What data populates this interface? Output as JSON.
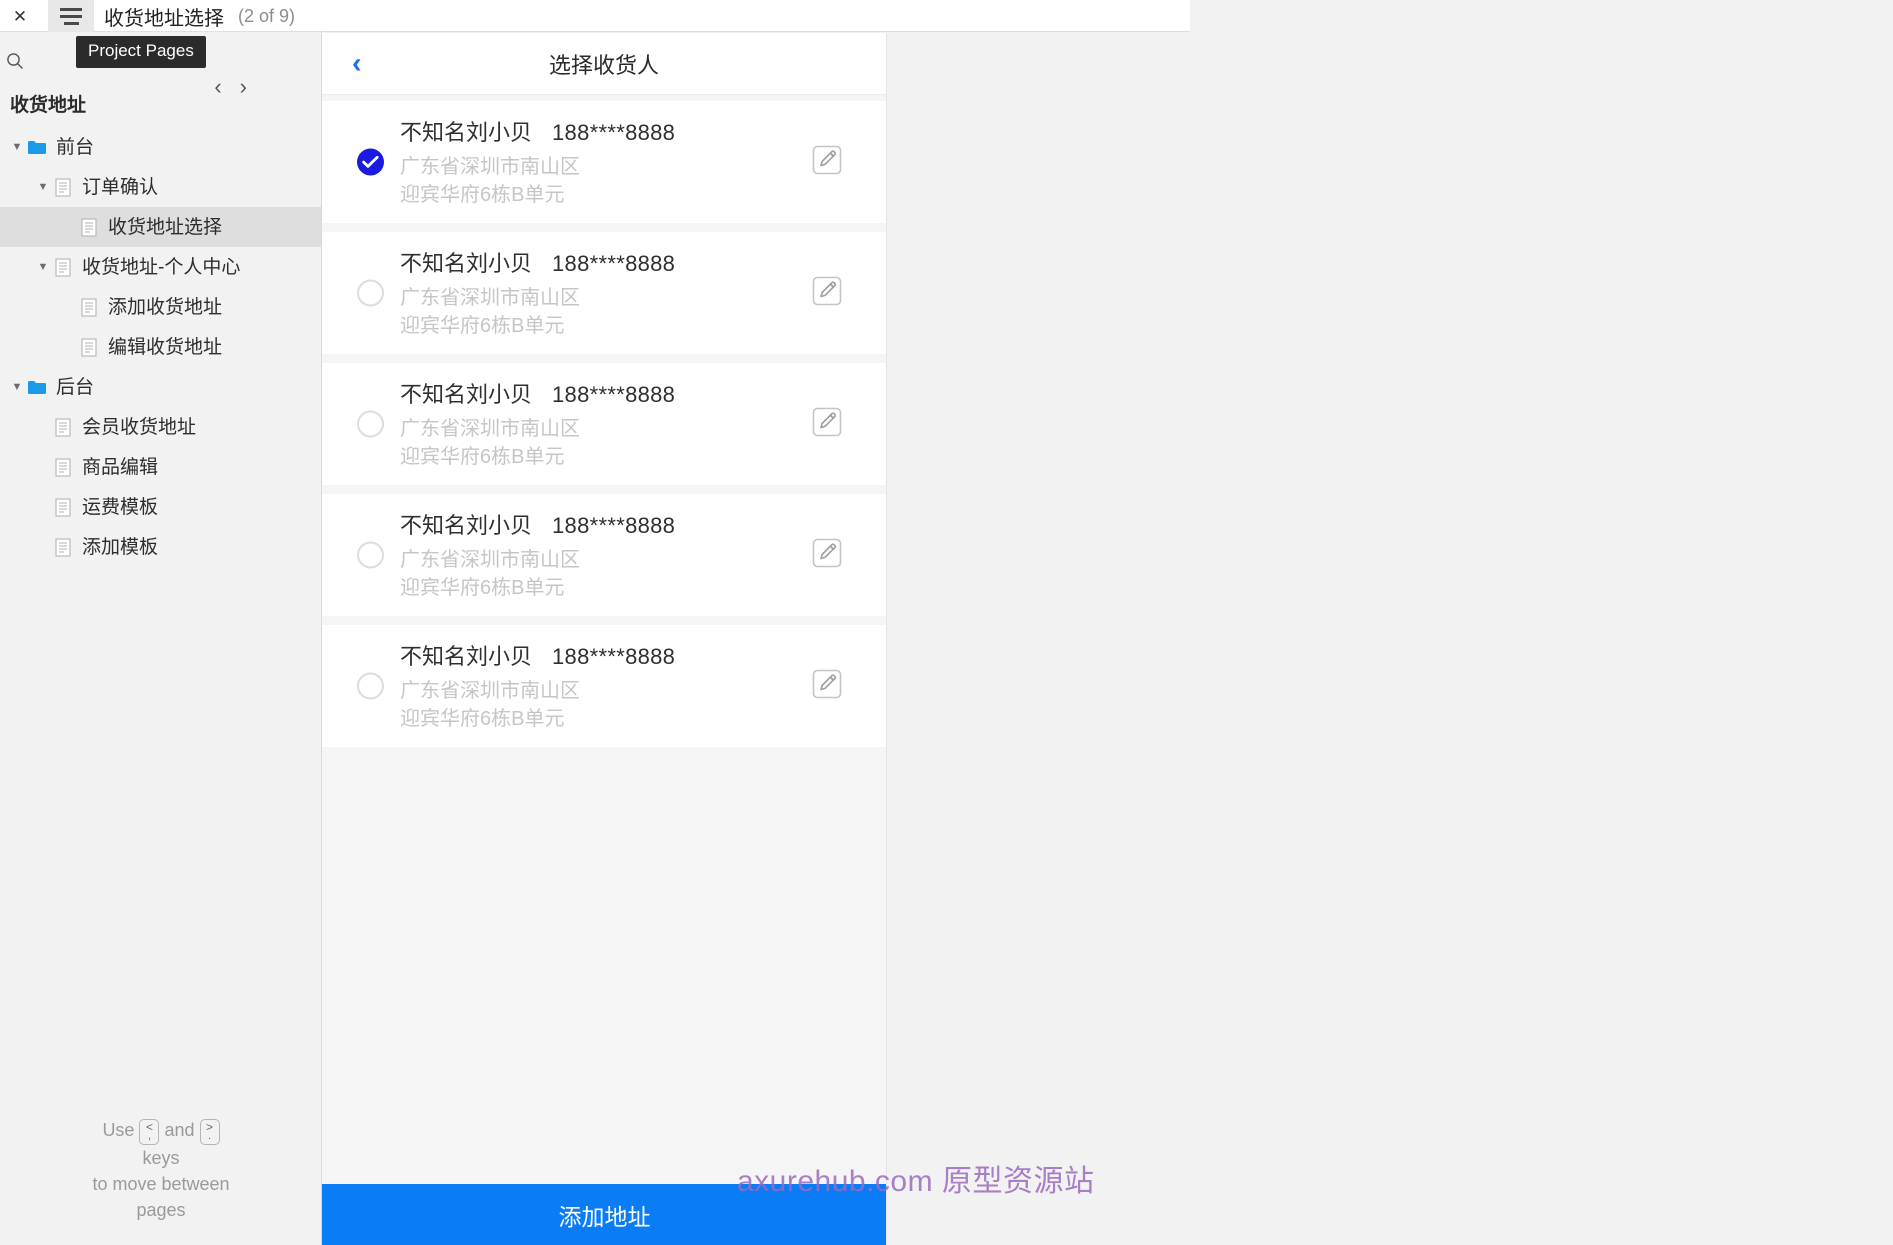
{
  "topbar": {
    "close_label": "✕",
    "menu_icon": "hamburger-icon",
    "page_title": "收货地址选择",
    "page_count": "(2 of 9)",
    "tooltip": "Project Pages"
  },
  "sidebar": {
    "heading": "收货地址",
    "prev_label": "‹",
    "next_label": "›",
    "tree": [
      {
        "label": "前台",
        "type": "folder",
        "depth": 0,
        "caret": "▼",
        "selected": false
      },
      {
        "label": "订单确认",
        "type": "page",
        "depth": 1,
        "caret": "▼",
        "selected": false
      },
      {
        "label": "收货地址选择",
        "type": "page",
        "depth": 2,
        "caret": "",
        "selected": true
      },
      {
        "label": "收货地址-个人中心",
        "type": "page",
        "depth": 1,
        "caret": "▼",
        "selected": false
      },
      {
        "label": "添加收货地址",
        "type": "page",
        "depth": 2,
        "caret": "",
        "selected": false
      },
      {
        "label": "编辑收货地址",
        "type": "page",
        "depth": 2,
        "caret": "",
        "selected": false
      },
      {
        "label": "后台",
        "type": "folder",
        "depth": 0,
        "caret": "▼",
        "selected": false
      },
      {
        "label": "会员收货地址",
        "type": "page",
        "depth": 1,
        "caret": "",
        "selected": false
      },
      {
        "label": "商品编辑",
        "type": "page",
        "depth": 1,
        "caret": "",
        "selected": false
      },
      {
        "label": "运费模板",
        "type": "page",
        "depth": 1,
        "caret": "",
        "selected": false
      },
      {
        "label": "添加模板",
        "type": "page",
        "depth": 1,
        "caret": "",
        "selected": false
      }
    ],
    "help": {
      "use": "Use",
      "key_prev_1": "<",
      "key_prev_2": ",",
      "and": "and",
      "key_next_1": ">",
      "key_next_2": ".",
      "keys": "keys",
      "line3": "to move between",
      "line4": "pages"
    }
  },
  "phone": {
    "header_title": "选择收货人",
    "back_label": "‹",
    "add_button": "添加地址",
    "addresses": [
      {
        "name": "不知名刘小贝",
        "phone": "188****8888",
        "line1": "广东省深圳市南山区",
        "line2": "迎宾华府6栋B单元",
        "selected": true
      },
      {
        "name": "不知名刘小贝",
        "phone": "188****8888",
        "line1": "广东省深圳市南山区",
        "line2": "迎宾华府6栋B单元",
        "selected": false
      },
      {
        "name": "不知名刘小贝",
        "phone": "188****8888",
        "line1": "广东省深圳市南山区",
        "line2": "迎宾华府6栋B单元",
        "selected": false
      },
      {
        "name": "不知名刘小贝",
        "phone": "188****8888",
        "line1": "广东省深圳市南山区",
        "line2": "迎宾华府6栋B单元",
        "selected": false
      },
      {
        "name": "不知名刘小贝",
        "phone": "188****8888",
        "line1": "广东省深圳市南山区",
        "line2": "迎宾华府6栋B单元",
        "selected": false
      }
    ]
  },
  "watermark": "axurehub.com 原型资源站",
  "colors": {
    "accent_blue": "#0a7cf5",
    "radio_blue": "#1a1ae0",
    "back_chevron": "#1677e8",
    "watermark": "#9b6bbf"
  }
}
